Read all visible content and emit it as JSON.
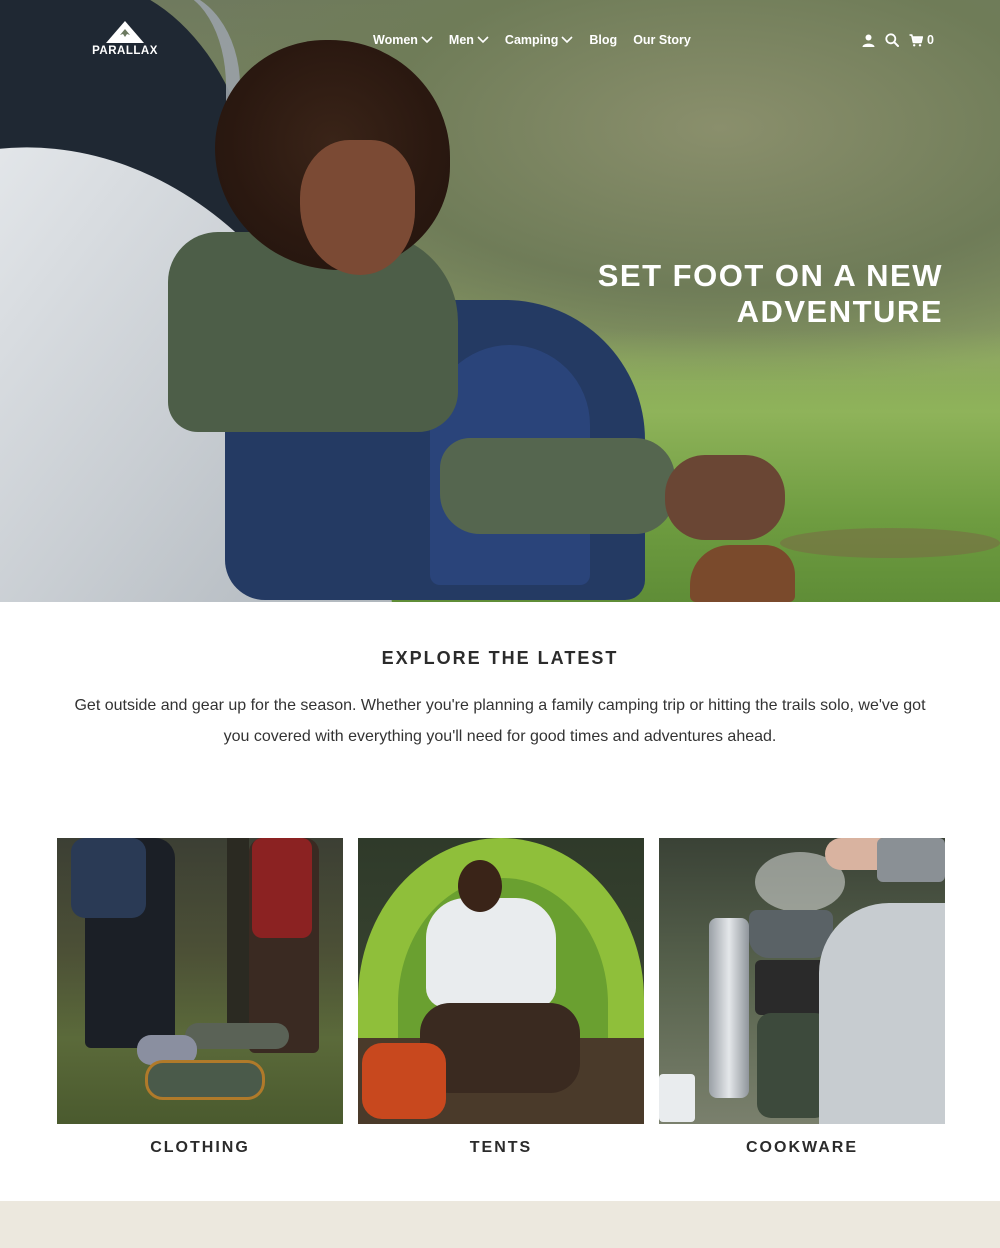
{
  "brand": {
    "name": "PARALLAX"
  },
  "nav": {
    "items": [
      {
        "label": "Women",
        "has_dropdown": true
      },
      {
        "label": "Men",
        "has_dropdown": true
      },
      {
        "label": "Camping",
        "has_dropdown": true
      },
      {
        "label": "Blog",
        "has_dropdown": false
      },
      {
        "label": "Our Story",
        "has_dropdown": false
      }
    ],
    "utilities": {
      "account_icon": "user-icon",
      "search_icon": "search-icon",
      "cart_icon": "cart-icon",
      "cart_count": "0"
    }
  },
  "hero": {
    "heading_line1": "SET FOOT ON A NEW",
    "heading_line2": "ADVENTURE"
  },
  "explore": {
    "title": "EXPLORE THE LATEST",
    "body": "Get outside and gear up for the season. Whether you're planning a family camping trip or hitting the trails solo, we've got you covered with everything you'll need for good times and adventures ahead."
  },
  "collections": [
    {
      "label": "CLOTHING"
    },
    {
      "label": "TENTS"
    },
    {
      "label": "COOKWARE"
    }
  ],
  "colors": {
    "text_dark": "#2b2b2b",
    "nav_text": "#ffffff",
    "footer_band": "#ece8de"
  }
}
